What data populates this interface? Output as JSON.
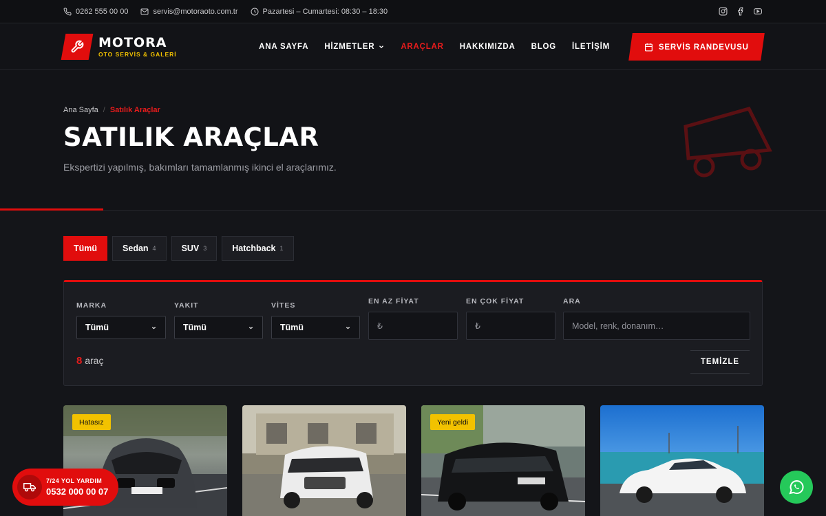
{
  "topbar": {
    "phone": "0262 555 00 00",
    "email": "servis@motoraoto.com.tr",
    "hours": "Pazartesi – Cumartesi: 08:30 – 18:30",
    "socials": [
      "instagram-icon",
      "facebook-icon",
      "youtube-icon"
    ]
  },
  "brand": {
    "name": "MOTORA",
    "tagline": "OTO SERVİS & GALERİ",
    "accent": "#e10d0d",
    "tagline_color": "#f2c200"
  },
  "nav": {
    "items": [
      {
        "label": "ANA SAYFA"
      },
      {
        "label": "HİZMETLER"
      },
      {
        "label": "ARAÇLAR"
      },
      {
        "label": "HAKKIMIZDA"
      },
      {
        "label": "BLOG"
      },
      {
        "label": "İLETİŞİM"
      }
    ],
    "active": "ARAÇLAR",
    "cta_label": "SERVİS RANDEVUSU"
  },
  "hero": {
    "breadcrumb_home": "Ana Sayfa",
    "breadcrumb_sep": "/",
    "breadcrumb_current": "Satılık Araçlar",
    "title": "SATILIK ARAÇLAR",
    "subtitle": "Ekspertizi yapılmış, bakımları tamamlanmış ikinci el araçlarımız."
  },
  "tabs": [
    {
      "label": "Tümü",
      "count": "",
      "active": true
    },
    {
      "label": "Sedan",
      "count": "4"
    },
    {
      "label": "SUV",
      "count": "3"
    },
    {
      "label": "Hatchback",
      "count": "1"
    }
  ],
  "filters": {
    "brand": {
      "label": "MARKA",
      "value": "Tümü"
    },
    "fuel": {
      "label": "YAKIT",
      "value": "Tümü"
    },
    "gear": {
      "label": "VİTES",
      "value": "Tümü"
    },
    "min_price": {
      "label": "EN AZ FİYAT",
      "placeholder": "₺"
    },
    "max_price": {
      "label": "EN ÇOK FİYAT",
      "placeholder": "₺"
    },
    "search": {
      "label": "ARA",
      "placeholder": "Model, renk, donanım…"
    },
    "result_count": "8",
    "result_unit": "araç",
    "clear_label": "TEMİZLE"
  },
  "cars": [
    {
      "badge": "Hatasız",
      "plate": "H604BH123"
    },
    {
      "badge": ""
    },
    {
      "badge": "Yeni geldi"
    },
    {
      "badge": ""
    }
  ],
  "roadside": {
    "title": "7/24 YOL YARDIM",
    "phone": "0532 000 00 07"
  }
}
